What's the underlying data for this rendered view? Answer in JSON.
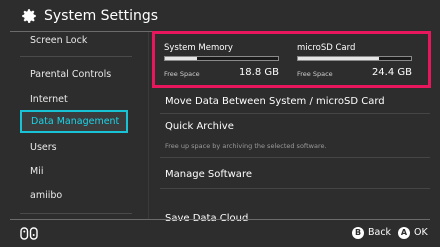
{
  "header": {
    "title": "System Settings",
    "icon": "gear-icon"
  },
  "sidebar": {
    "items": [
      {
        "label": "Screen Lock"
      },
      {
        "label": "Parental Controls"
      },
      {
        "label": "Internet"
      },
      {
        "label": "Data Management",
        "selected": true
      },
      {
        "label": "Users"
      },
      {
        "label": "Mii"
      },
      {
        "label": "amiibo"
      }
    ]
  },
  "storage": {
    "system": {
      "name": "System Memory",
      "free_label": "Free Space",
      "free_value": "18.8 GB",
      "used_fraction": 0.28
    },
    "sd": {
      "name": "microSD Card",
      "free_label": "Free Space",
      "free_value": "24.4 GB",
      "used_fraction": 0.72
    },
    "highlight_color": "#e8175d"
  },
  "content": {
    "move_data": "Move Data Between System / microSD Card",
    "quick_archive": "Quick Archive",
    "quick_archive_desc": "Free up space by archiving the selected software.",
    "manage_software": "Manage Software",
    "save_data_cloud": "Save Data Cloud"
  },
  "footer": {
    "back_button": "B",
    "back_label": "Back",
    "ok_button": "A",
    "ok_label": "OK"
  },
  "colors": {
    "background": "#2d2d2d",
    "selected_accent": "#19c3d6"
  }
}
